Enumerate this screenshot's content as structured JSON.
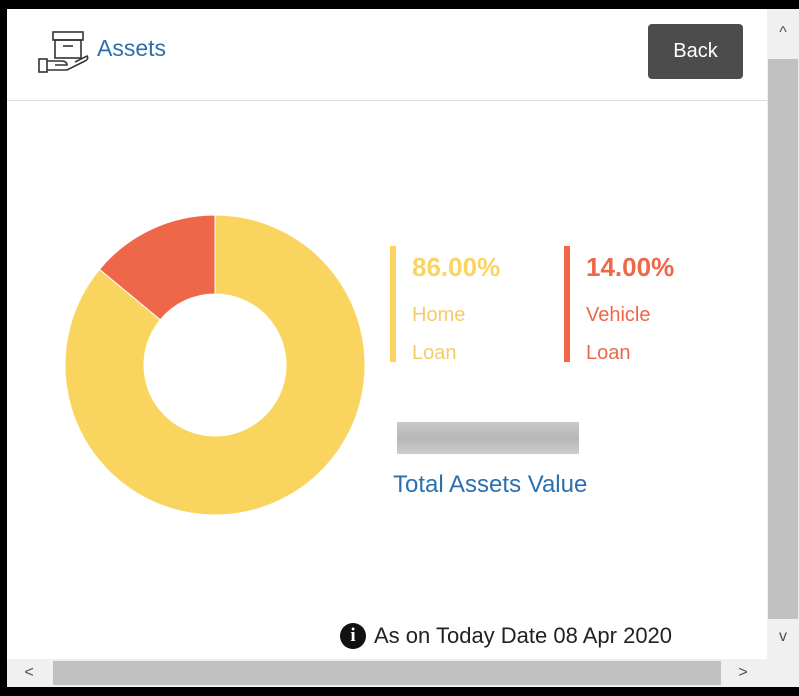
{
  "header": {
    "title": "Assets",
    "back_label": "Back",
    "icon": "hand-holding-box-icon"
  },
  "chart_data": {
    "type": "pie",
    "donut": true,
    "slices": [
      {
        "label": "Home Loan",
        "value": 86.0,
        "display": "86.00%",
        "line1": "Home",
        "line2": "Loan",
        "color": "#f9d55f"
      },
      {
        "label": "Vehicle Loan",
        "value": 14.0,
        "display": "14.00%",
        "line1": "Vehicle",
        "line2": "Loan",
        "color": "#ee6748"
      }
    ]
  },
  "summary": {
    "total_label": "Total Assets Value"
  },
  "footer": {
    "info_icon": "info-icon",
    "text": "As on Today Date 08 Apr 2020"
  },
  "scrollbars": {
    "up": "^",
    "down": "v",
    "left": "<",
    "right": ">"
  }
}
